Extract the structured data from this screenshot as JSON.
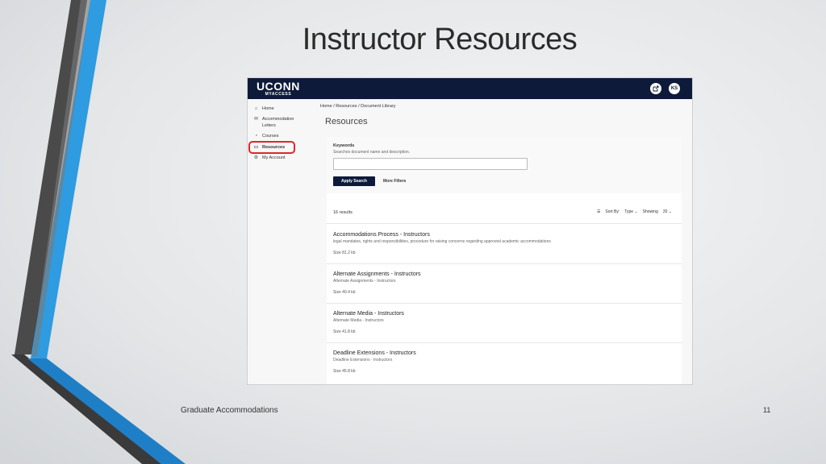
{
  "slide": {
    "title": "Instructor Resources",
    "footer_left": "Graduate Accommodations",
    "page_number": "11"
  },
  "app": {
    "logo_main": "UCONN",
    "logo_sub": "MYACCESS",
    "user_initials": "KS",
    "edit_icon": "external-link-icon"
  },
  "sidebar": {
    "items": [
      {
        "icon": "home-icon",
        "glyph": "⌂",
        "label": "Home"
      },
      {
        "icon": "letters-icon",
        "glyph": "✉",
        "label": "Accommodation Letters"
      },
      {
        "icon": "courses-icon",
        "glyph": "◔",
        "label": "Courses"
      },
      {
        "icon": "resources-icon",
        "glyph": "▭",
        "label": "Resources",
        "active": true
      },
      {
        "icon": "account-icon",
        "glyph": "⚙",
        "label": "My Account"
      }
    ]
  },
  "breadcrumb": "Home  /  Resources  /  Document Library",
  "page_heading": "Resources",
  "search": {
    "keywords_label": "Keywords",
    "keywords_help": "Searches document name and description.",
    "keywords_value": "",
    "apply_label": "Apply Search",
    "more_filters_label": "More Filters"
  },
  "results_header": {
    "count": "16 results",
    "sort_label": "Sort By:",
    "sort_value": "Type",
    "showing_label": "Showing",
    "showing_value": "20"
  },
  "results": [
    {
      "title": "Accommodations Process - Instructors",
      "description": "legal mandates, rights and responsibilities, procedure for raising concerns regarding approved academic accommodations",
      "size": "Size 81.2 kb"
    },
    {
      "title": "Alternate Assignments - Instructors",
      "description": "Alternate Assignments - Instructors",
      "size": "Size 40.4 kb"
    },
    {
      "title": "Alternate Media - Instructors",
      "description": "Alternate Media - Instructors",
      "size": "Size 41.8 kb"
    },
    {
      "title": "Deadline Extensions - Instructors",
      "description": "Deadline Extensions - Instructors",
      "size": "Size 45.8 kb"
    }
  ]
}
